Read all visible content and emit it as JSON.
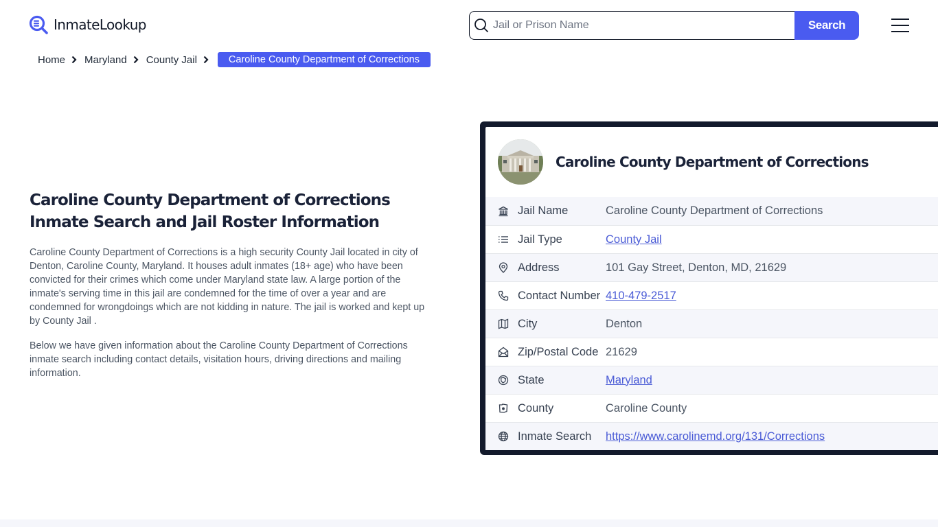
{
  "header": {
    "logo_text": "InmateLookup",
    "search": {
      "placeholder": "Jail or Prison Name",
      "value": "",
      "button_label": "Search"
    }
  },
  "colors": {
    "accent": "#4a5bf0",
    "dark": "#131a2c",
    "link": "#4a5bd6",
    "row_alt": "#f5f6fb"
  },
  "breadcrumb": {
    "items": [
      "Home",
      "Maryland",
      "County Jail"
    ],
    "current": "Caroline County Department of Corrections"
  },
  "intro": {
    "title_line1": "Caroline County Department of Corrections",
    "title_line2": "Inmate Search and Jail Roster Information",
    "paragraph1": "Caroline County Department of Corrections is a high security County Jail located in city of Denton, Caroline County, Maryland. It houses adult inmates (18+ age) who have been convicted for their crimes which come under Maryland state law. A large portion of the inmate's serving time in this jail are condemned for the time of over a year and are condemned for wrongdoings which are not kidding in nature. The jail is worked and kept up by County Jail .",
    "paragraph2": "Below we have given information about the Caroline County Department of Corrections inmate search including contact details, visitation hours, driving directions and mailing information."
  },
  "card": {
    "title": "Caroline County Department of Corrections",
    "image_alt": "building-photo",
    "rows": [
      {
        "icon": "bank-icon",
        "label": "Jail Name",
        "value": "Caroline County Department of Corrections",
        "link": false
      },
      {
        "icon": "list-icon",
        "label": "Jail Type",
        "value": "County Jail",
        "link": true
      },
      {
        "icon": "map-pin-icon",
        "label": "Address",
        "value": "101 Gay Street, Denton, MD, 21629",
        "link": false
      },
      {
        "icon": "phone-icon",
        "label": "Contact Number",
        "value": "410-479-2517",
        "link": true
      },
      {
        "icon": "map-icon",
        "label": "City",
        "value": "Denton",
        "link": false
      },
      {
        "icon": "mail-open-icon",
        "label": "Zip/Postal Code",
        "value": "21629",
        "link": false
      },
      {
        "icon": "state-icon",
        "label": "State",
        "value": "Maryland",
        "link": true
      },
      {
        "icon": "county-icon",
        "label": "County",
        "value": "Caroline County",
        "link": false
      },
      {
        "icon": "globe-icon",
        "label": "Inmate Search",
        "value": "https://www.carolinemd.org/131/Corrections",
        "link": true
      }
    ]
  }
}
